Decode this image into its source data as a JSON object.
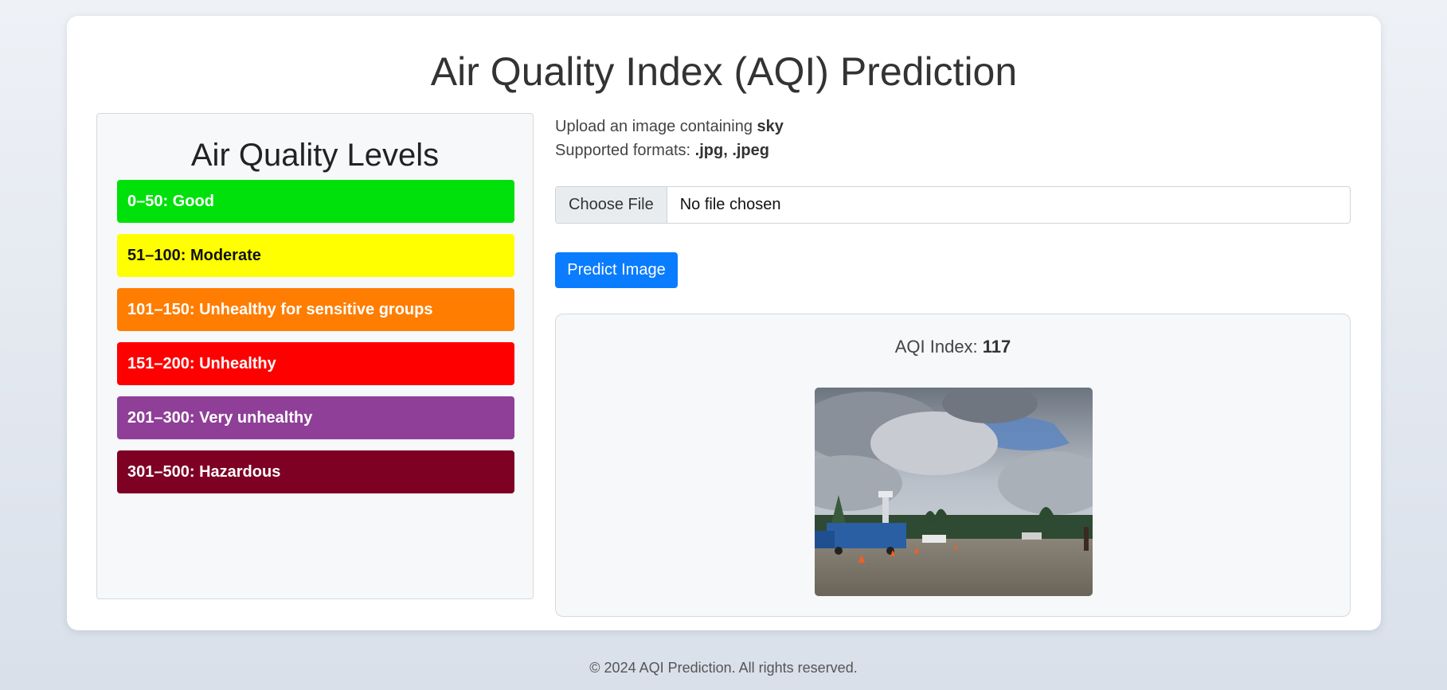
{
  "header": {
    "title": "Air Quality Index (AQI) Prediction"
  },
  "levels": {
    "title": "Air Quality Levels",
    "items": [
      {
        "label": "0–50: Good",
        "bg": "#00e10c",
        "fg": "#ffffff"
      },
      {
        "label": "51–100: Moderate",
        "bg": "#ffff00",
        "fg": "#111111"
      },
      {
        "label": "101–150: Unhealthy for sensitive groups",
        "bg": "#ff7d00",
        "fg": "#ffffff"
      },
      {
        "label": "151–200: Unhealthy",
        "bg": "#ff0000",
        "fg": "#ffffff"
      },
      {
        "label": "201–300: Very unhealthy",
        "bg": "#8f3f98",
        "fg": "#ffffff"
      },
      {
        "label": "301–500: Hazardous",
        "bg": "#7e0023",
        "fg": "#ffffff"
      }
    ]
  },
  "upload": {
    "line1_prefix": "Upload an image containing ",
    "line1_bold": "sky",
    "line2_prefix": "Supported formats: ",
    "line2_bold": ".jpg, .jpeg",
    "choose_file_label": "Choose File",
    "file_status": "No file chosen",
    "predict_label": "Predict Image"
  },
  "result": {
    "aqi_prefix": "AQI Index: ",
    "aqi_value": "117"
  },
  "footer": {
    "text": "© 2024 AQI Prediction. All rights reserved."
  },
  "colors": {
    "primary": "#0a7cff",
    "card_bg": "#ffffff",
    "panel_bg": "#f6f8fa"
  }
}
